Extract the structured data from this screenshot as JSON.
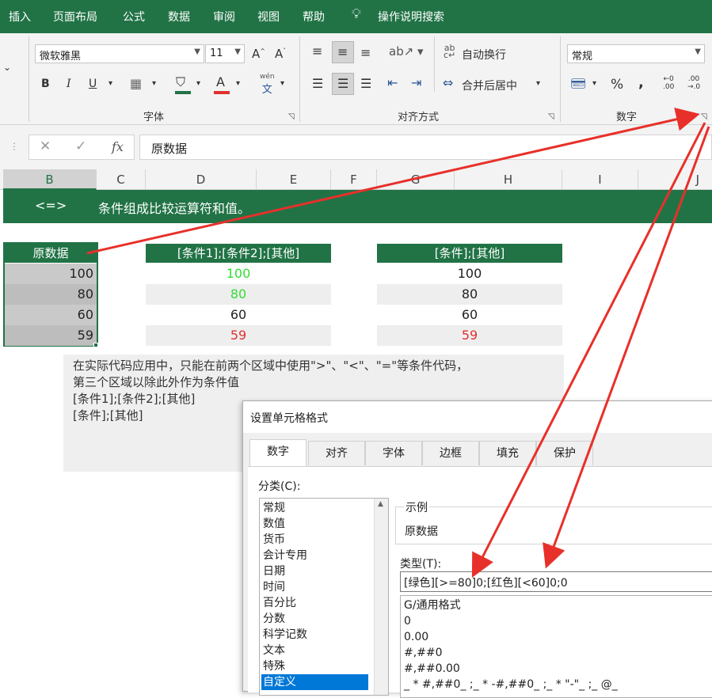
{
  "menu": [
    "插入",
    "页面布局",
    "公式",
    "数据",
    "审阅",
    "视图",
    "帮助"
  ],
  "tell_me": "操作说明搜索",
  "ribbon": {
    "font_name": "微软雅黑",
    "font_size": "11",
    "bold": "B",
    "italic": "I",
    "underline": "U",
    "font_color_glyph": "A",
    "grow_font": "A",
    "shrink_font": "A",
    "phonetic": "wén",
    "phonetic_char": "文",
    "wrap_text": "自动换行",
    "merge_center": "合并后居中",
    "number_format": "常规",
    "percent": "%",
    "comma": ",",
    "inc_decimal_top": "←0",
    "inc_decimal_bottom": ".00",
    "dec_decimal_top": ".00",
    "dec_decimal_bottom": "→.0",
    "group_font": "字体",
    "group_align": "对齐方式",
    "group_number": "数字"
  },
  "formula_bar": {
    "fx": "fx",
    "value": "原数据"
  },
  "columns": [
    "B",
    "C",
    "D",
    "E",
    "F",
    "G",
    "H",
    "I",
    "J"
  ],
  "banner": {
    "left": "<=>",
    "text": "条件组成比较运算符和值。"
  },
  "table1": {
    "header": "原数据",
    "values": [
      "100",
      "80",
      "60",
      "59"
    ]
  },
  "table2": {
    "header": "[条件1];[条件2];[其他]",
    "values": [
      "100",
      "80",
      "60",
      "59"
    ],
    "colors": [
      "#33dd33",
      "#33dd33",
      "#222222",
      "#e03030"
    ]
  },
  "table3": {
    "header": "[条件];[其他]",
    "values": [
      "100",
      "80",
      "60",
      "59"
    ],
    "colors": [
      "#222222",
      "#222222",
      "#222222",
      "#e03030"
    ]
  },
  "note": {
    "line1": "在实际代码应用中，只能在前两个区域中使用\">\"、\"<\"、\"=\"等条件代码，",
    "line2": "第三个区域以除此外作为条件值",
    "line3": "[条件1];[条件2];[其他]",
    "line4": "[条件];[其他]"
  },
  "dialog": {
    "title": "设置单元格格式",
    "tabs": [
      "数字",
      "对齐",
      "字体",
      "边框",
      "填充",
      "保护"
    ],
    "category_label": "分类(C):",
    "categories": [
      "常规",
      "数值",
      "货币",
      "会计专用",
      "日期",
      "时间",
      "百分比",
      "分数",
      "科学记数",
      "文本",
      "特殊",
      "自定义"
    ],
    "sample_label": "示例",
    "sample_value": "原数据",
    "type_label": "类型(T):",
    "type_value": "[绿色][>=80]0;[红色][<60]0;0",
    "formats": [
      "G/通用格式",
      "0",
      "0.00",
      "#,##0",
      "#,##0.00",
      "_ * #,##0_ ;_ * -#,##0_ ;_ * \"-\"_ ;_ @_"
    ]
  },
  "colors": {
    "excel_green": "#217346",
    "arrow_red": "#e8302a",
    "selected_blue": "#0078d7"
  }
}
